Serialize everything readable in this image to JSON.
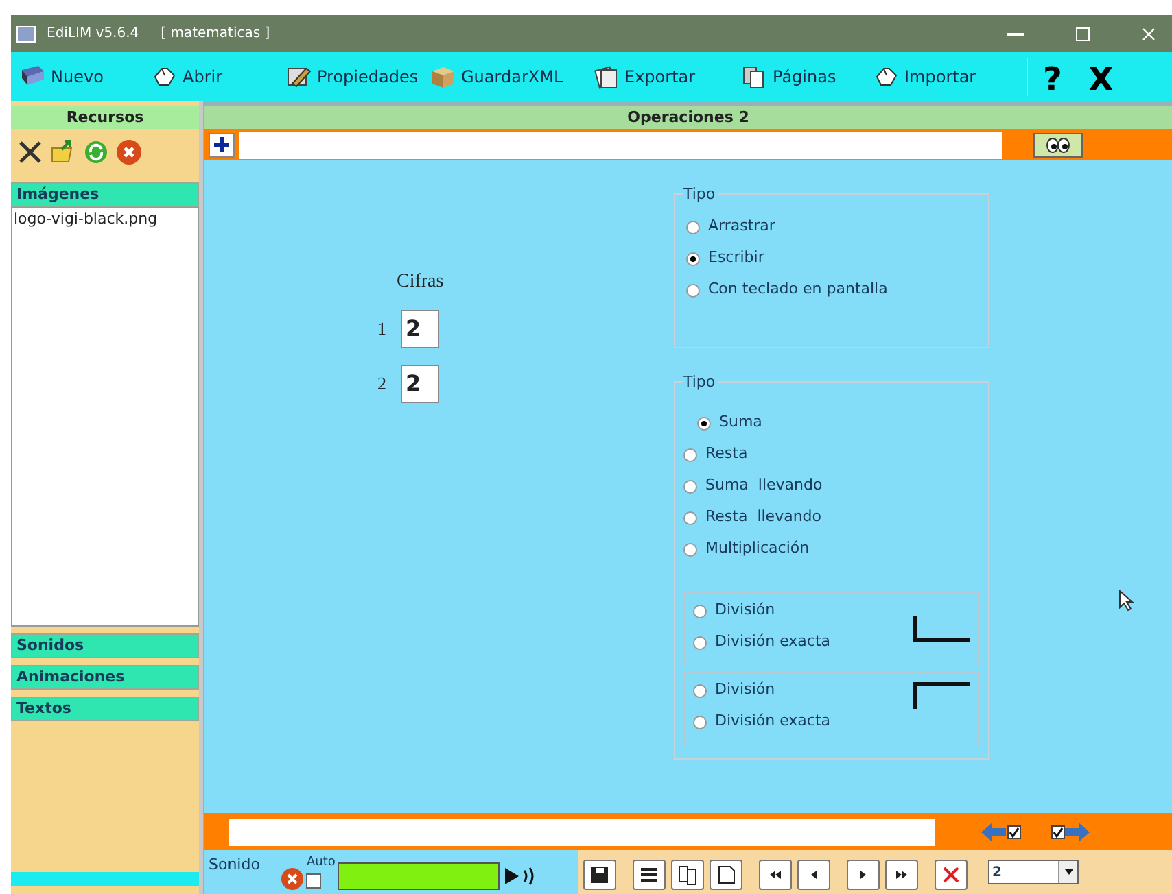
{
  "window": {
    "title": "EdiLIM v5.6.4",
    "project": "[ matematicas ]"
  },
  "toolbar": [
    {
      "label": "Nuevo"
    },
    {
      "label": "Abrir"
    },
    {
      "label": "Propiedades"
    },
    {
      "label": "GuardarXML"
    },
    {
      "label": "Exportar"
    },
    {
      "label": "Páginas"
    },
    {
      "label": "Importar"
    }
  ],
  "help": "?",
  "exit": "X",
  "sidebar": {
    "header": "Recursos",
    "sections": [
      {
        "label": "Imágenes",
        "expanded": true,
        "items": [
          "logo-vigi-black.png"
        ]
      },
      {
        "label": "Sonidos",
        "expanded": false
      },
      {
        "label": "Animaciones",
        "expanded": false
      },
      {
        "label": "Textos",
        "expanded": false
      }
    ]
  },
  "page": {
    "title": "Operaciones 2",
    "cifras": {
      "label": "Cifras",
      "rows": [
        {
          "label": "1",
          "value": "2"
        },
        {
          "label": "2",
          "value": "2"
        }
      ]
    },
    "tipo_modo": {
      "legend": "Tipo",
      "options": [
        {
          "label": "Arrastrar",
          "selected": false
        },
        {
          "label": "Escribir",
          "selected": true
        },
        {
          "label": "Con teclado en pantalla",
          "selected": false
        }
      ]
    },
    "tipo_operacion": {
      "legend": "Tipo",
      "options": [
        {
          "label": "Suma",
          "selected": true
        },
        {
          "label": "Resta",
          "selected": false
        },
        {
          "label": "Suma  llevando",
          "selected": false
        },
        {
          "label": "Resta  llevando",
          "selected": false
        },
        {
          "label": "Multiplicación",
          "selected": false
        }
      ],
      "groups": [
        {
          "kind": "lower",
          "options": [
            {
              "label": "División",
              "selected": false
            },
            {
              "label": "División exacta",
              "selected": false
            }
          ]
        },
        {
          "kind": "upper",
          "options": [
            {
              "label": "División",
              "selected": false
            },
            {
              "label": "División exacta",
              "selected": false
            }
          ]
        }
      ]
    }
  },
  "footer": {
    "back_checked": true,
    "forward_checked": true,
    "sound_label": "Sonido",
    "auto": {
      "label": "Auto",
      "checked": false
    },
    "page_select": "2"
  }
}
